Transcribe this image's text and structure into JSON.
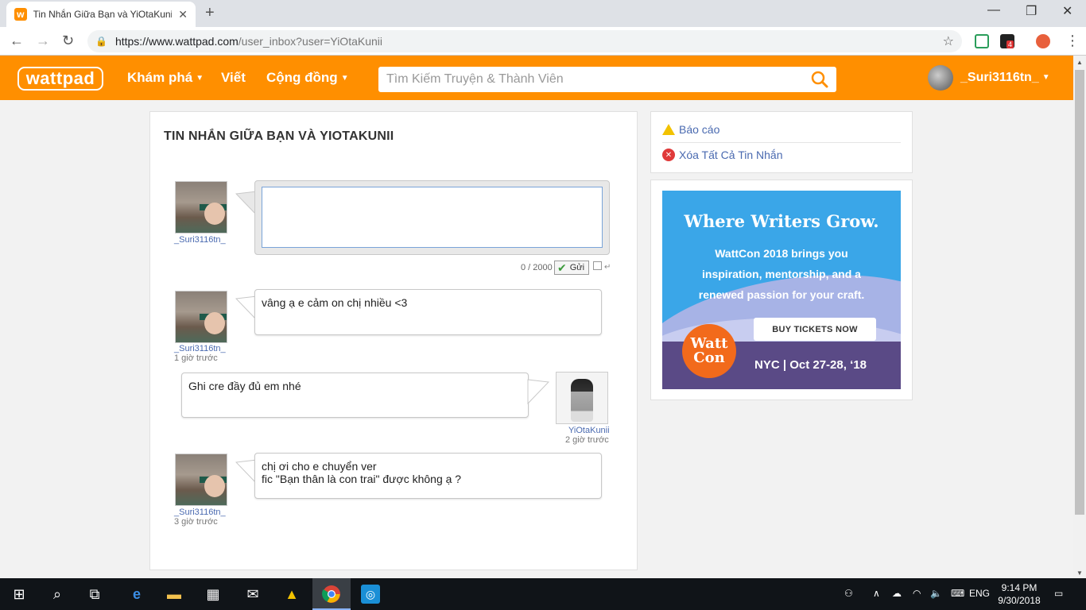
{
  "browser": {
    "tab_title": "Tin Nhắn Giữa Bạn và YiOtaKunii",
    "url_host": "https://www.wattpad.com",
    "url_path": "/user_inbox?user=YiOtaKunii",
    "extension_badge": "4"
  },
  "header": {
    "logo": "wattpad",
    "nav": {
      "explore": "Khám phá",
      "write": "Viết",
      "community": "Cộng đồng"
    },
    "search_placeholder": "Tìm Kiếm Truyện & Thành Viên",
    "username": "_Suri3116tn_",
    "brand_color": "#ff8f00"
  },
  "conversation": {
    "title": "TIN NHẮN GIỮA BẠN VÀ YIOTAKUNII",
    "compose": {
      "value": "",
      "counter": "0 / 2000",
      "send_label": "Gửi"
    },
    "messages": [
      {
        "user": "_Suri3116tn_",
        "time": "1 giờ trước",
        "text": "vâng ạ e cảm on chị nhiều <3",
        "side": "left"
      },
      {
        "user": "YiOtaKunii",
        "time": "2 giờ trước",
        "text": "Ghi cre đầy đủ em nhé",
        "side": "right"
      },
      {
        "user": "_Suri3116tn_",
        "time": "3 giờ trước",
        "text": "chị ơi cho e chuyển ver\n fic \"Bạn thân là con trai\" được không ạ ?",
        "side": "left"
      }
    ],
    "compose_user": "_Suri3116tn_"
  },
  "actions": {
    "report": "Báo cáo",
    "delete_all": "Xóa Tất Cả Tin Nhắn"
  },
  "ad": {
    "title": "Where Writers Grow.",
    "body": "WattCon 2018 brings you\ninspiration, mentorship, and a\nrenewed passion for your craft.",
    "button": "BUY TICKETS NOW",
    "logo": "Watt\nCon",
    "date": "NYC | Oct 27-28, ‘18"
  },
  "taskbar": {
    "language": "ENG",
    "time": "9:14 PM",
    "date": "9/30/2018"
  }
}
